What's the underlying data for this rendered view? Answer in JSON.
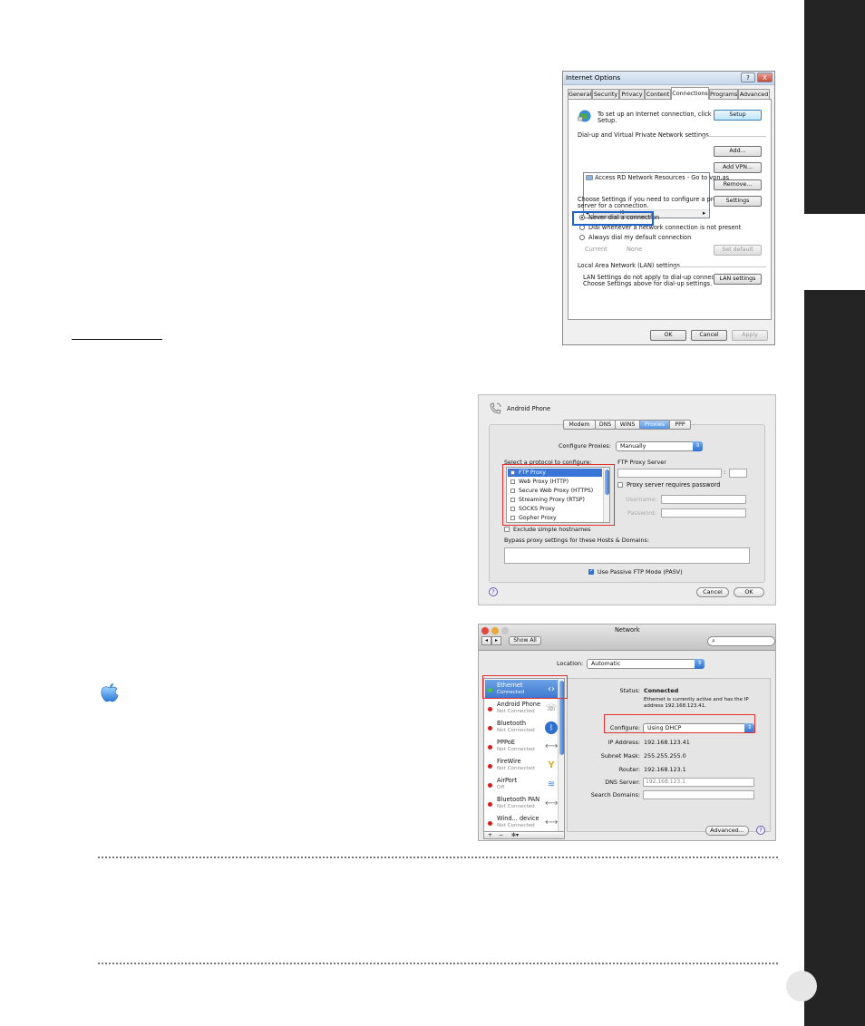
{
  "internet_options": {
    "title": "Internet Options",
    "title_help": "?",
    "title_close": "X",
    "tabs": [
      "General",
      "Security",
      "Privacy",
      "Content",
      "Connections",
      "Programs",
      "Advanced"
    ],
    "setup_text_1": "To set up an Internet connection, click",
    "setup_text_2": "Setup.",
    "setup_button": "Setup",
    "dialup_group": "Dial-up and Virtual Private Network settings",
    "dialup_item": "Access RD Network Resources - Go to vpn.as",
    "scroll_left": "◂",
    "scroll_mid": "III",
    "scroll_right": "▸",
    "add_button": "Add...",
    "add_vpn_button": "Add VPN...",
    "remove_button": "Remove...",
    "proxy_text_1": "Choose Settings if you need to configure a proxy",
    "proxy_text_2": "server for a connection.",
    "settings_button": "Settings",
    "radio_never": "Never dial a connection",
    "radio_dial_whenever": "Dial whenever a network connection is not present",
    "radio_always": "Always dial my default connection",
    "current_label": "Current",
    "current_value": "None",
    "set_default_button": "Set default",
    "lan_group": "Local Area Network (LAN) settings",
    "lan_text_1": "LAN Settings do not apply to dial-up connections.",
    "lan_text_2": "Choose Settings above for dial-up settings.",
    "lan_button": "LAN settings",
    "ok_button": "OK",
    "cancel_button": "Cancel",
    "apply_button": "Apply"
  },
  "proxies": {
    "title": "Android Phone",
    "tabs": [
      "Modem",
      "DNS",
      "WINS",
      "Proxies",
      "PPP"
    ],
    "active_tab": "Proxies",
    "configure_label": "Configure Proxies:",
    "configure_value": "Manually",
    "protocol_label": "Select a protocol to configure:",
    "protocols": [
      "FTP Proxy",
      "Web Proxy (HTTP)",
      "Secure Web Proxy (HTTPS)",
      "Streaming Proxy (RTSP)",
      "SOCKS Proxy",
      "Gopher Proxy"
    ],
    "server_label": "FTP Proxy Server",
    "colon": ":",
    "requires_password": "Proxy server requires password",
    "username_label": "Username:",
    "password_label": "Password:",
    "exclude_simple": "Exclude simple hostnames",
    "bypass_label": "Bypass proxy settings for these Hosts & Domains:",
    "passive_ftp": "Use Passive FTP Mode (PASV)",
    "help": "?",
    "cancel_button": "Cancel",
    "ok_button": "OK"
  },
  "network": {
    "title": "Network",
    "back": "◂",
    "forward": "▸",
    "show_all": "Show All",
    "search_icon": "⌕",
    "location_label": "Location:",
    "location_value": "Automatic",
    "services": [
      {
        "name": "Ethernet",
        "status": "Connected",
        "icon": "‹›"
      },
      {
        "name": "Android Phone",
        "status": "Not Connected",
        "icon": "☏"
      },
      {
        "name": "Bluetooth",
        "status": "Not Connected",
        "icon": "ᛒ"
      },
      {
        "name": "PPPoE",
        "status": "Not Connected",
        "icon": "⟷"
      },
      {
        "name": "FireWire",
        "status": "Not Connected",
        "icon": "Y"
      },
      {
        "name": "AirPort",
        "status": "Off",
        "icon": "≋"
      },
      {
        "name": "Bluetooth PAN",
        "status": "Not Connected",
        "icon": "⟷"
      },
      {
        "name": "Wind... device",
        "status": "Not Connected",
        "icon": "⟷"
      }
    ],
    "status_label": "Status:",
    "status_value": "Connected",
    "status_desc_1": "Ethernet is currently active and has the IP",
    "status_desc_2": "address 192.168.123.41.",
    "configure_label": "Configure:",
    "configure_value": "Using DHCP",
    "ip_label": "IP Address:",
    "ip_value": "192.168.123.41",
    "subnet_label": "Subnet Mask:",
    "subnet_value": "255.255.255.0",
    "router_label": "Router:",
    "router_value": "192.168.123.1",
    "dns_label": "DNS Server:",
    "dns_value": "192.168.123.1",
    "search_domains_label": "Search Domains:",
    "advanced_button": "Advanced...",
    "help": "?",
    "add_service": "+",
    "remove_service": "−",
    "gear_menu": "✻▾"
  }
}
